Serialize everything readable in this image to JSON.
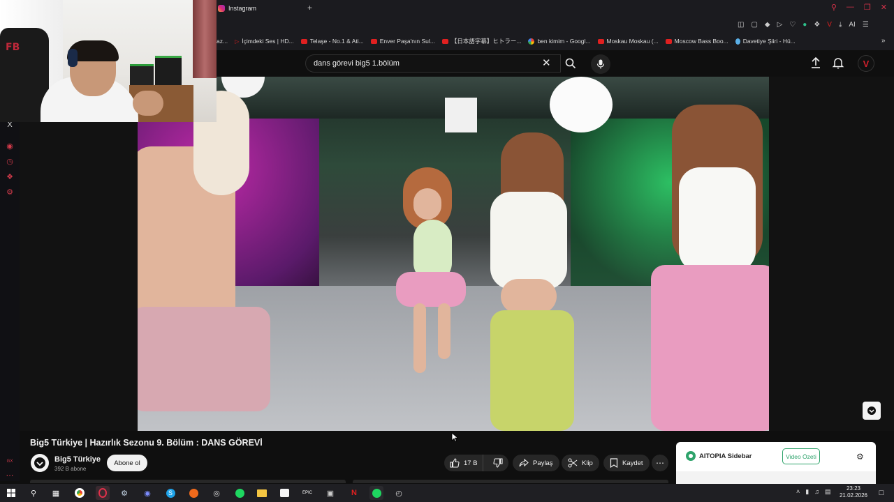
{
  "browser": {
    "tab_title": "Instagram",
    "new_tab_symbol": "+",
    "bookmarks": [
      {
        "label": "az...",
        "icon": "none"
      },
      {
        "label": "İçimdeki Ses | HD...",
        "icon": "play"
      },
      {
        "label": "Telaşe - No.1 & Ati...",
        "icon": "youtube"
      },
      {
        "label": "Enver Paşa'nın Sul...",
        "icon": "youtube"
      },
      {
        "label": "【日本語字幕】ヒトラー...",
        "icon": "youtube"
      },
      {
        "label": "ben kimim - Googl...",
        "icon": "google"
      },
      {
        "label": "Moskau Moskau (...",
        "icon": "youtube"
      },
      {
        "label": "Moscow Bass Boo...",
        "icon": "youtube"
      },
      {
        "label": "Davetiye Şiiri - Hü...",
        "icon": "drop"
      }
    ],
    "ai_label": "AI"
  },
  "youtube": {
    "search_value": "dans görevi big5 1.bölüm",
    "video_title": "Big5 Türkiye | Hazırlık Sezonu 9. Bölüm : DANS GÖREVİ",
    "channel_name": "Big5 Türkiye",
    "channel_subs": "392 B abone",
    "subscribe_label": "Abone ol",
    "likes": "17 B",
    "share_label": "Paylaş",
    "clip_label": "Klip",
    "save_label": "Kaydet",
    "avatar_letter": "V"
  },
  "aitopia": {
    "title": "AITOPIA Sidebar",
    "summary_button": "Video Özeti"
  },
  "webcam": {
    "chair_logo": "FB"
  },
  "sidebar": {
    "close_symbol": "X",
    "gx_label": "GX"
  },
  "taskbar": {
    "time": "23:23",
    "date": "21.02.2026",
    "epic_label": "EPIC"
  },
  "colors": {
    "accent": "#d23a4a",
    "youtube_red": "#e02020",
    "aitopia_green": "#2ea36b"
  }
}
